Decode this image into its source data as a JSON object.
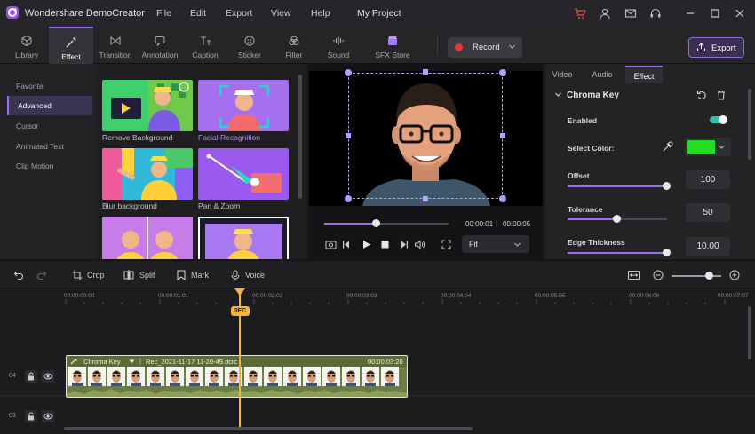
{
  "app": {
    "name": "Wondershare DemoCreator",
    "project": "My Project",
    "menu": [
      "File",
      "Edit",
      "Export",
      "View",
      "Help"
    ]
  },
  "toolbar": {
    "tools": [
      {
        "label": "Library",
        "icon": "cube-icon"
      },
      {
        "label": "Effect",
        "icon": "magic-wand-icon",
        "active": true
      },
      {
        "label": "Transition",
        "icon": "transition-icon"
      },
      {
        "label": "Annotation",
        "icon": "speech-bubble-icon"
      },
      {
        "label": "Caption",
        "icon": "caption-icon"
      },
      {
        "label": "Sticker",
        "icon": "smiley-icon"
      },
      {
        "label": "Filter",
        "icon": "filter-icon"
      },
      {
        "label": "Sound",
        "icon": "waveform-icon"
      },
      {
        "label": "SFX Store",
        "icon": "store-icon"
      }
    ],
    "record_label": "Record",
    "export_label": "Export"
  },
  "left_nav": {
    "items": [
      "Favorite",
      "Advanced",
      "Cursor",
      "Animated Text",
      "Clip Motion"
    ],
    "active": "Advanced"
  },
  "effects": {
    "items": [
      {
        "label": "Remove Background",
        "selected": false
      },
      {
        "label": "Facial Recognition",
        "selected": true
      },
      {
        "label": "Blur background",
        "selected": false
      },
      {
        "label": "Pan & Zoom",
        "selected": false
      },
      {
        "label": "",
        "selected": false
      },
      {
        "label": "",
        "selected": false
      }
    ]
  },
  "preview": {
    "current_time": "00:00:01",
    "total_time": "00:00:05",
    "progress": 0.42,
    "fit_label": "Fit"
  },
  "right_panel": {
    "tabs": [
      "Video",
      "Audio",
      "Effect"
    ],
    "active_tab": "Effect",
    "section_title": "Chroma Key",
    "enabled_label": "Enabled",
    "enabled": true,
    "select_color_label": "Select Color:",
    "selected_color": "#22dd22",
    "offset": {
      "label": "Offset",
      "value": "100",
      "fraction": 1.0
    },
    "tolerance": {
      "label": "Tolerance",
      "value": "50",
      "fraction": 0.5
    },
    "edge_thickness": {
      "label": "Edge Thickness",
      "value": "10.00",
      "fraction": 1.0
    }
  },
  "timeline_toolbar": {
    "crop_label": "Crop",
    "split_label": "Split",
    "mark_label": "Mark",
    "voice_label": "Voice"
  },
  "timeline": {
    "ruler": [
      "00:00:00:00",
      "00:00:01:01",
      "00:00:02:02",
      "00:00:03:03",
      "00:00:04:04",
      "00:00:05:05",
      "00:00:06:06",
      "00:00:07:07"
    ],
    "playhead_label": "3EC",
    "tracks": [
      {
        "number": "04"
      },
      {
        "number": "03"
      }
    ],
    "clip": {
      "effect": "Chroma Key",
      "name": "Rec_2021-11-17 11-20-49.dcrc",
      "duration": "00:00:03:20"
    }
  },
  "colors": {
    "accent": "#9a6cf7",
    "record": "#e23b3b",
    "playhead": "#f4b63a"
  }
}
